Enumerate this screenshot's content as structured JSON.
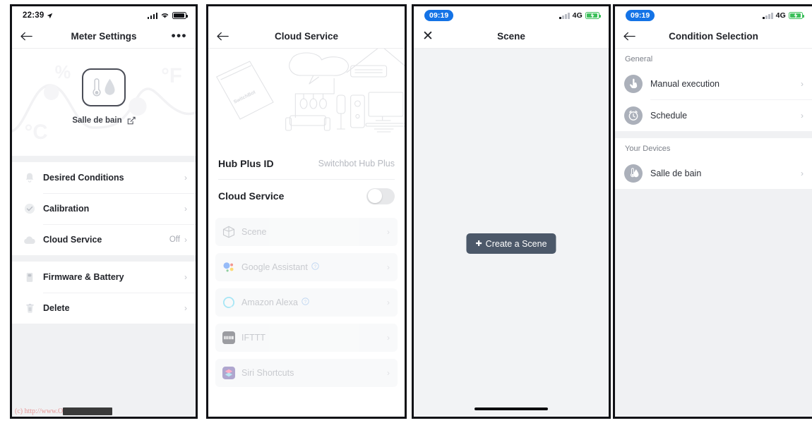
{
  "panel1": {
    "statusbar": {
      "time": "22:39",
      "icons": [
        "location-arrow-icon",
        "cellular-icon",
        "wifi-icon",
        "battery-icon"
      ]
    },
    "nav": {
      "back": "←",
      "title": "Meter Settings",
      "more": "•••"
    },
    "hero": {
      "device_name": "Salle de bain",
      "edit_icon": "edit-pencil-icon",
      "bg_symbols": [
        "%",
        "°F",
        "°C"
      ]
    },
    "rows": [
      {
        "icon": "bell-icon",
        "label": "Desired Conditions",
        "value": "",
        "chevron": "›"
      },
      {
        "icon": "check-circle-icon",
        "label": "Calibration",
        "value": "",
        "chevron": "›"
      },
      {
        "icon": "cloud-icon",
        "label": "Cloud Service",
        "value": "Off",
        "chevron": "›"
      }
    ],
    "rows2": [
      {
        "icon": "battery-firmware-icon",
        "label": "Firmware & Battery",
        "value": "",
        "chevron": "›"
      },
      {
        "icon": "trash-icon",
        "label": "Delete",
        "value": "",
        "chevron": "›"
      }
    ],
    "watermark": "(c) http://www.O"
  },
  "panel2": {
    "nav": {
      "back": "←",
      "title": "Cloud Service"
    },
    "illustration": {
      "brand_icons": [
        "google-assistant-icon",
        "ifttt-icon",
        "amazon-alexa-icon",
        "siri-shortcuts-icon"
      ],
      "phone_label": "SwitchBot"
    },
    "hub": {
      "label": "Hub Plus ID",
      "value": "Switchbot Hub Plus"
    },
    "cloud": {
      "label": "Cloud Service",
      "toggle_state": "off"
    },
    "services": [
      {
        "icon": "scene-cube-icon",
        "label": "Scene",
        "help": false,
        "chevron": "›"
      },
      {
        "icon": "google-assistant-icon",
        "label": "Google Assistant",
        "help": true,
        "chevron": "›"
      },
      {
        "icon": "amazon-alexa-icon",
        "label": "Amazon Alexa",
        "help": true,
        "chevron": "›"
      },
      {
        "icon": "ifttt-icon",
        "label": "IFTTT",
        "help": false,
        "chevron": "›"
      },
      {
        "icon": "siri-shortcuts-icon",
        "label": "Siri Shortcuts",
        "help": false,
        "chevron": "›"
      }
    ]
  },
  "panel3": {
    "statusbar": {
      "time": "09:19",
      "network": "4G",
      "battery": "charging"
    },
    "nav": {
      "close": "✕",
      "title": "Scene"
    },
    "create_button": {
      "plus": "✚",
      "label": "Create a Scene"
    },
    "home_indicator": true
  },
  "panel4": {
    "statusbar": {
      "time": "09:19",
      "network": "4G",
      "battery": "charging"
    },
    "nav": {
      "back": "←",
      "title": "Condition Selection"
    },
    "groups": [
      {
        "header": "General",
        "items": [
          {
            "icon": "hand-tap-icon",
            "label": "Manual execution",
            "chevron": "›"
          },
          {
            "icon": "alarm-clock-icon",
            "label": "Schedule",
            "chevron": "›"
          }
        ]
      },
      {
        "header": "Your Devices",
        "items": [
          {
            "icon": "meter-thermo-humidity-icon",
            "label": "Salle de bain",
            "chevron": "›"
          }
        ]
      }
    ]
  },
  "colors": {
    "accent_blue": "#1473E6",
    "button_slate": "#4c5869",
    "icon_gray": "#abb0ba",
    "screen_bg": "#f0f1f3",
    "text_dark": "#22242a"
  }
}
